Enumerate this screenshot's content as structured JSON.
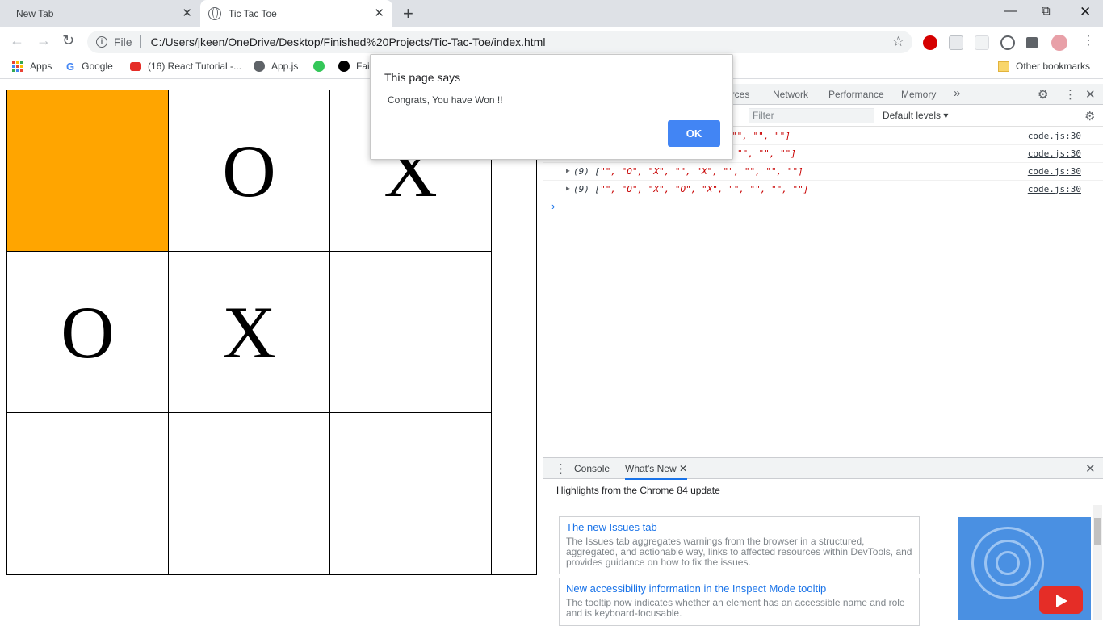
{
  "browser": {
    "tabs": [
      {
        "title": "New Tab",
        "active": false
      },
      {
        "title": "Tic Tac Toe",
        "active": true
      }
    ],
    "omnibox": {
      "scheme": "File",
      "url": "C:/Users/jkeen/OneDrive/Desktop/Finished%20Projects/Tic-Tac-Toe/index.html"
    },
    "bookmarks": [
      {
        "label": "Apps",
        "icon": "apps-grid-icon"
      },
      {
        "label": "Google",
        "icon": "google-icon"
      },
      {
        "label": "(16) React Tutorial -...",
        "icon": "youtube-icon"
      },
      {
        "label": "App.js",
        "icon": "globe-icon"
      },
      {
        "label": "",
        "icon": "green-app-icon"
      },
      {
        "label": "Fai",
        "icon": "f-icon"
      }
    ],
    "other_bookmarks": "Other bookmarks"
  },
  "game": {
    "cells": [
      "",
      "O",
      "X",
      "O",
      "X",
      "",
      "",
      "",
      ""
    ],
    "highlight_color": "#ffa500"
  },
  "devtools": {
    "tabs": [
      "urces",
      "Network",
      "Performance",
      "Memory"
    ],
    "filter_placeholder": "Filter",
    "levels": "Default levels ▾",
    "logs": [
      {
        "prefix": "",
        "text": "\"\", \"\", \"\"]",
        "source": "code.js:30",
        "expander": false
      },
      {
        "prefix": "",
        "text": "\"\", \"\", \"\"]",
        "source": "code.js:30",
        "expander": false
      },
      {
        "prefix": "(9) [",
        "text": "\"\", \"O\", \"X\", \"\", \"X\", \"\", \"\", \"\", \"\"]",
        "source": "code.js:30",
        "expander": true
      },
      {
        "prefix": "(9) [",
        "text": "\"\", \"O\", \"X\", \"O\", \"X\", \"\", \"\", \"\", \"\"]",
        "source": "code.js:30",
        "expander": true
      }
    ],
    "drawer": {
      "tabs": [
        "Console",
        "What's New"
      ],
      "highlights": "Highlights from the Chrome 84 update",
      "cards": [
        {
          "title": "The new Issues tab",
          "body": "The Issues tab aggregates warnings from the browser in a structured, aggregated, and actionable way, links to affected resources within DevTools, and provides guidance on how to fix the issues."
        },
        {
          "title": "New accessibility information in the Inspect Mode tooltip",
          "body": "The tooltip now indicates whether an element has an accessible name and role and is keyboard-focusable."
        }
      ]
    }
  },
  "dialog": {
    "title": "This page says",
    "message": "Congrats, You have Won !!",
    "ok": "OK"
  }
}
